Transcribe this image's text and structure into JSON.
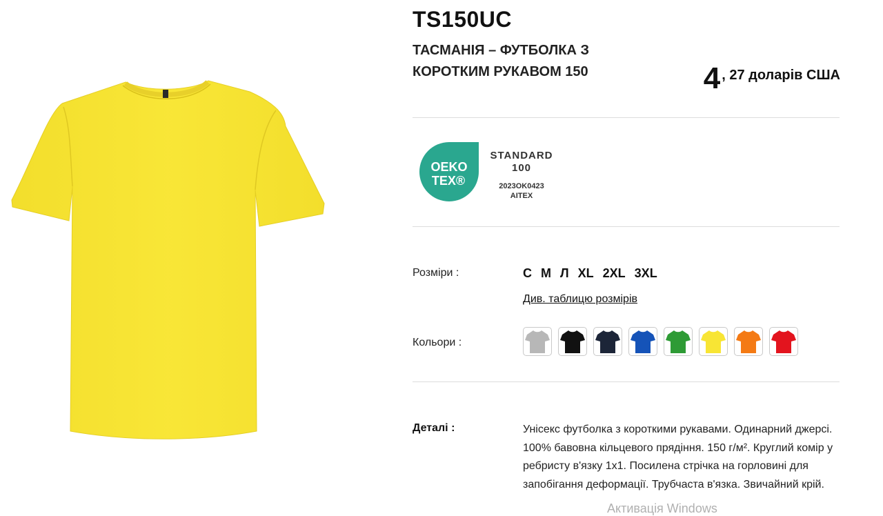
{
  "product": {
    "sku": "TS150UC",
    "name": "ТАСМАНІЯ – ФУТБОЛКА З КОРОТКИМ РУКАВОМ 150",
    "image_color": "#f8e534",
    "image_icon": "yellow-tshirt-image"
  },
  "price": {
    "integer": "4",
    "rest": ", 27 доларів США"
  },
  "certification": {
    "logo_line1": "OEKO",
    "logo_line2": "TEX®",
    "standard": "STANDARD",
    "number": "100",
    "code": "2023OK0423",
    "lab": "AITEX",
    "color": "#2aa78f"
  },
  "sizes": {
    "label": "Розміри :",
    "items": [
      "С",
      "М",
      "Л",
      "XL",
      "2XL",
      "3XL"
    ],
    "table_link": "Див. таблицю розмірів"
  },
  "colors": {
    "label": "Кольори :",
    "items": [
      {
        "name": "grey",
        "hex": "#b7b7b7"
      },
      {
        "name": "black",
        "hex": "#111111"
      },
      {
        "name": "navy",
        "hex": "#1c2538"
      },
      {
        "name": "royal-blue",
        "hex": "#1553b8"
      },
      {
        "name": "green",
        "hex": "#2e9b35"
      },
      {
        "name": "yellow",
        "hex": "#f8e534"
      },
      {
        "name": "orange",
        "hex": "#f47a14"
      },
      {
        "name": "red",
        "hex": "#e3141e"
      }
    ]
  },
  "details": {
    "label": "Деталі :",
    "text": "Унісекс футболка з короткими рукавами. Одинарний джерсі. 100% бавовна кільцевого прядіння. 150 г/м². Круглий комір у ребристу в'язку 1x1. Посилена стрічка на горловині для запобігання деформації. Трубчаста в'язка. Звичайний крій."
  },
  "watermark": "Активація Windows"
}
